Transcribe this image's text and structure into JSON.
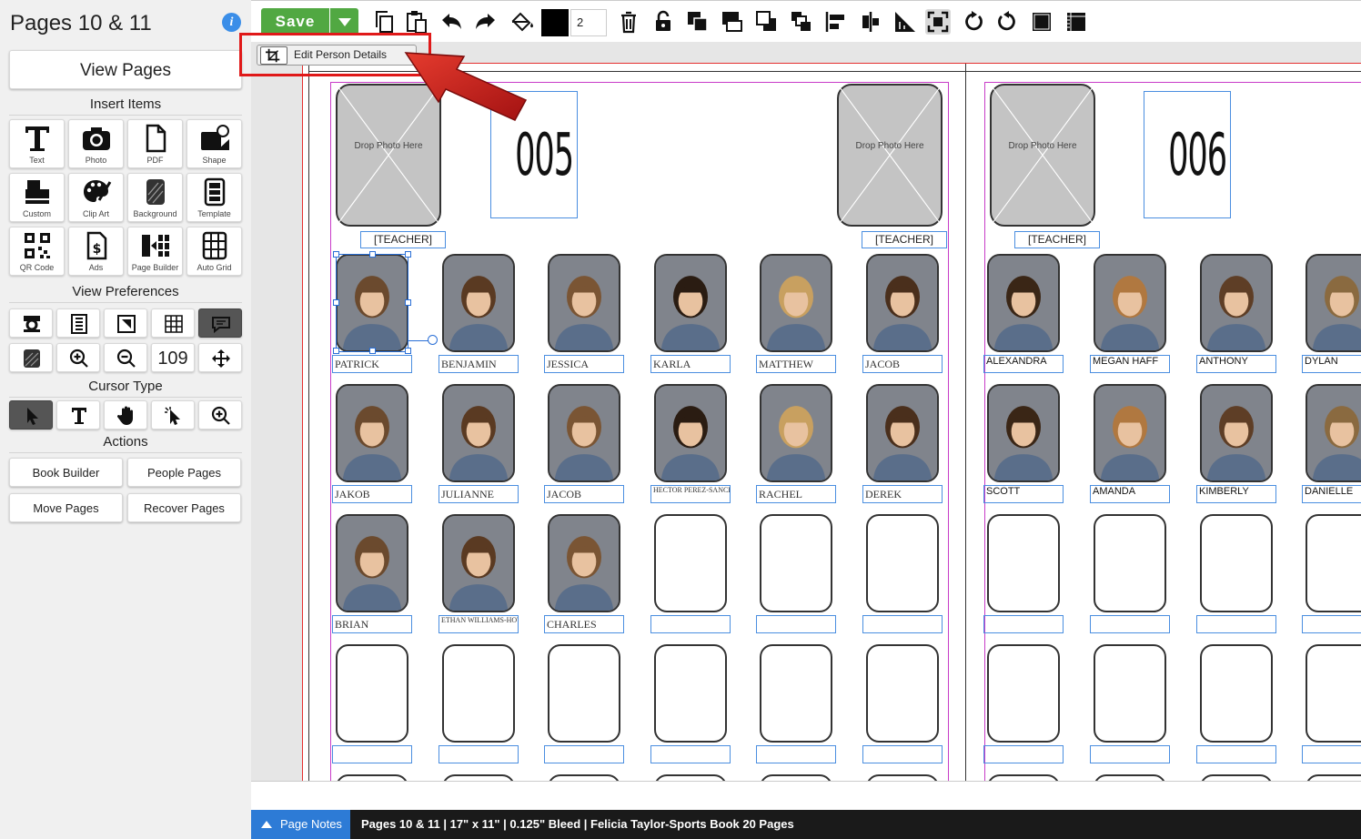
{
  "sidebar": {
    "title": "Pages 10 & 11",
    "view_pages": "View Pages",
    "insert_items_title": "Insert Items",
    "insert_items": [
      {
        "label": "Text",
        "icon": "text-icon"
      },
      {
        "label": "Photo",
        "icon": "camera-icon"
      },
      {
        "label": "PDF",
        "icon": "pdf-icon"
      },
      {
        "label": "Shape",
        "icon": "shape-icon"
      },
      {
        "label": "Custom",
        "icon": "custom-icon"
      },
      {
        "label": "Clip Art",
        "icon": "palette-icon"
      },
      {
        "label": "Background",
        "icon": "background-icon"
      },
      {
        "label": "Template",
        "icon": "template-icon"
      },
      {
        "label": "QR Code",
        "icon": "qr-code-icon"
      },
      {
        "label": "Ads",
        "icon": "ads-icon"
      },
      {
        "label": "Page Builder",
        "icon": "page-builder-icon"
      },
      {
        "label": "Auto Grid",
        "icon": "auto-grid-icon"
      }
    ],
    "view_prefs_title": "View Preferences",
    "zoom_value": "109",
    "cursor_title": "Cursor Type",
    "actions_title": "Actions",
    "actions": [
      "Book Builder",
      "People Pages",
      "Move Pages",
      "Recover Pages"
    ]
  },
  "toolbar": {
    "save_label": "Save",
    "stroke_width": "2",
    "stroke_color": "#000000"
  },
  "edit_person_details": "Edit Person Details",
  "spread": {
    "left_page": {
      "page_number": "005",
      "teachers": [
        "[TEACHER]",
        "[TEACHER]"
      ],
      "drop_text": "Drop Photo Here",
      "rows": [
        [
          "PATRICK",
          "BENJAMIN",
          "JESSICA",
          "KARLA",
          "MATTHEW",
          "JACOB"
        ],
        [
          "JAKOB",
          "JULIANNE",
          "JACOB",
          "HECTOR PEREZ-SANCHEZ",
          "RACHEL",
          "DEREK"
        ],
        [
          "BRIAN",
          "ETHAN WILLIAMS-HOWELL",
          "CHARLES",
          "",
          "",
          ""
        ],
        [
          "",
          "",
          "",
          "",
          "",
          ""
        ]
      ]
    },
    "right_page": {
      "page_number": "006",
      "teachers": [
        "[TEACHER]"
      ],
      "drop_text": "Drop Photo Here",
      "rows": [
        [
          "ALEXANDRA",
          "MEGAN HAFF",
          "ANTHONY",
          "DYLAN"
        ],
        [
          "SCOTT",
          "AMANDA",
          "KIMBERLY",
          "DANIELLE"
        ],
        [
          "",
          "",
          "",
          ""
        ],
        [
          "",
          "",
          "",
          ""
        ]
      ]
    }
  },
  "status": {
    "page_notes": "Page Notes",
    "info": "Pages 10 & 11 | 17\" x 11\" | 0.125\" Bleed | Felicia Taylor-Sports Book 20 Pages"
  }
}
